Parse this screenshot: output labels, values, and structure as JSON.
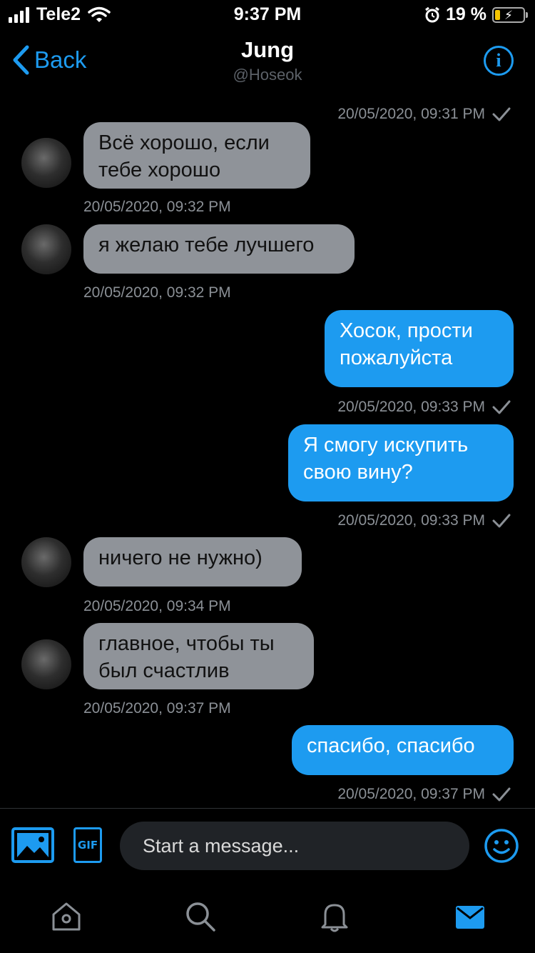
{
  "status_bar": {
    "carrier": "Tele2",
    "time": "9:37 PM",
    "battery_percent": "19 %",
    "battery_level": 0.19
  },
  "header": {
    "back_label": "Back",
    "title": "Jung",
    "handle": "@Hoseok",
    "info_icon": "info-icon",
    "accent_color": "#1d9bf0"
  },
  "messages": [
    {
      "direction": "out",
      "timestamp": "20/05/2020, 09:31 PM",
      "read": true
    },
    {
      "direction": "in",
      "lines": [
        "Всё хорошо, если",
        "тебе хорошо"
      ],
      "timestamp": "20/05/2020, 09:32 PM"
    },
    {
      "direction": "in",
      "lines": [
        "я желаю тебе лучшего"
      ],
      "timestamp": "20/05/2020, 09:32 PM"
    },
    {
      "direction": "out",
      "lines": [
        "Хосок, прости",
        "пожалуйста"
      ],
      "timestamp": "20/05/2020, 09:33 PM",
      "read": true
    },
    {
      "direction": "out",
      "lines": [
        "Я смогу искупить",
        "свою вину?"
      ],
      "timestamp": "20/05/2020, 09:33 PM",
      "read": true
    },
    {
      "direction": "in",
      "lines": [
        "ничего не нужно)"
      ],
      "timestamp": "20/05/2020, 09:34 PM"
    },
    {
      "direction": "in",
      "lines": [
        "главное, чтобы ты",
        "был счастлив"
      ],
      "timestamp": "20/05/2020, 09:37 PM"
    },
    {
      "direction": "out",
      "lines": [
        "спасибо, спасибо"
      ],
      "timestamp": "20/05/2020, 09:37 PM",
      "read": true
    }
  ],
  "composer": {
    "placeholder": "Start a message...",
    "media_icon": "image-icon",
    "gif_label": "GIF",
    "emoji_icon": "emoji-icon"
  },
  "tabbar": {
    "items": [
      "home-icon",
      "search-icon",
      "notifications-icon",
      "messages-icon"
    ],
    "active": "messages-icon"
  },
  "colors": {
    "incoming_bubble": "#8f9399",
    "outgoing_bubble": "#1d9bf0",
    "background": "#000000"
  }
}
